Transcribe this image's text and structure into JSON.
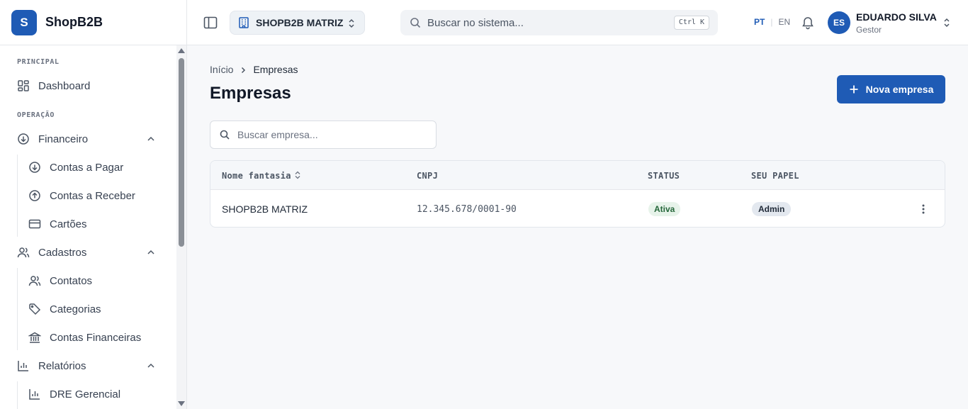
{
  "app": {
    "logo_letter": "S",
    "name": "ShopB2B"
  },
  "sidebar": {
    "sections": [
      {
        "label": "PRINCIPAL"
      },
      {
        "label": "OPERAÇÃO"
      }
    ],
    "items": {
      "dashboard": {
        "label": "Dashboard",
        "icon": "dashboard-icon"
      },
      "financeiro": {
        "label": "Financeiro",
        "icon": "arrow-down-circle-icon",
        "expanded": true
      },
      "contas_pagar": {
        "label": "Contas a Pagar",
        "icon": "arrow-down-circle-icon"
      },
      "contas_receber": {
        "label": "Contas a Receber",
        "icon": "arrow-up-circle-icon"
      },
      "cartoes": {
        "label": "Cartões",
        "icon": "credit-card-icon"
      },
      "cadastros": {
        "label": "Cadastros",
        "icon": "users-icon",
        "expanded": true
      },
      "contatos": {
        "label": "Contatos",
        "icon": "users-icon"
      },
      "categorias": {
        "label": "Categorias",
        "icon": "tag-icon"
      },
      "contas_financeiras": {
        "label": "Contas Financeiras",
        "icon": "bank-icon"
      },
      "relatorios": {
        "label": "Relatórios",
        "icon": "bar-chart-icon",
        "expanded": true
      },
      "dre": {
        "label": "DRE Gerencial",
        "icon": "bar-chart-icon"
      }
    }
  },
  "header": {
    "company": "SHOPB2B MATRIZ",
    "search_placeholder": "Buscar no sistema...",
    "shortcut": "Ctrl K",
    "lang_active": "PT",
    "lang_other": "EN",
    "user": {
      "initials": "ES",
      "name": "EDUARDO SILVA",
      "role": "Gestor"
    }
  },
  "main": {
    "breadcrumb": [
      "Início",
      "Empresas"
    ],
    "title": "Empresas",
    "new_button": "Nova empresa",
    "search_placeholder": "Buscar empresa...",
    "table": {
      "columns": [
        "Nome fantasia",
        "CNPJ",
        "STATUS",
        "SEU PAPEL"
      ],
      "rows": [
        {
          "name": "SHOPB2B MATRIZ",
          "cnpj": "12.345.678/0001-90",
          "status": "Ativa",
          "role": "Admin"
        }
      ]
    }
  },
  "colors": {
    "accent": "#1f5bb5",
    "status_active_bg": "#e7f3ea",
    "status_active_fg": "#25673a"
  }
}
